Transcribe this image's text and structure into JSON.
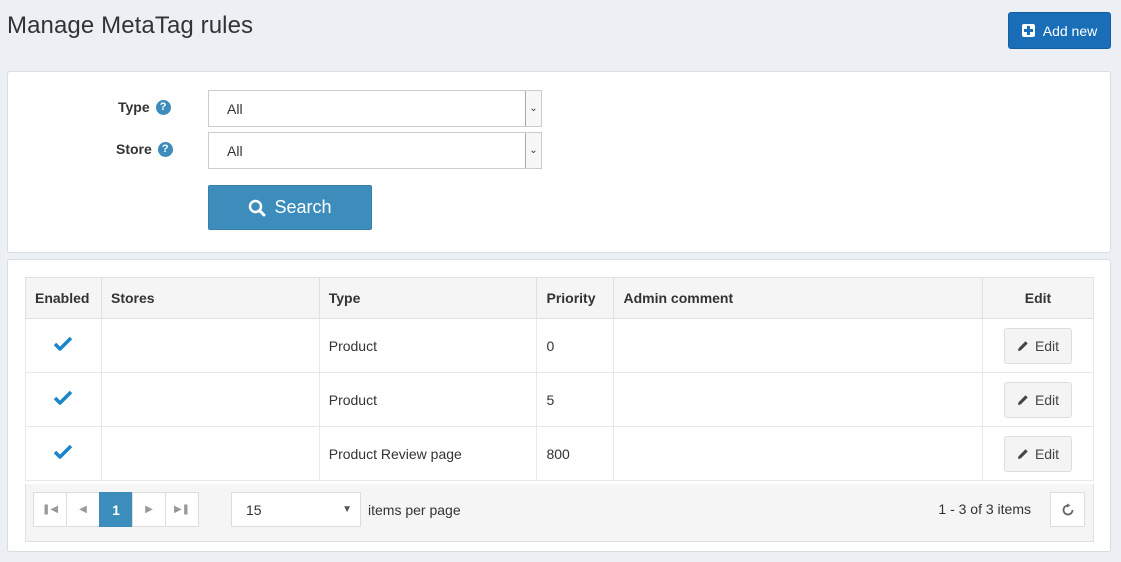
{
  "header": {
    "title": "Manage MetaTag rules",
    "add_new_label": "Add new"
  },
  "search": {
    "type_label": "Type",
    "type_value": "All",
    "store_label": "Store",
    "store_value": "All",
    "search_label": "Search"
  },
  "grid": {
    "columns": [
      "Enabled",
      "Stores",
      "Type",
      "Priority",
      "Admin comment",
      "Edit"
    ],
    "rows": [
      {
        "enabled": true,
        "stores": "",
        "type": "Product",
        "priority": "0",
        "comment": "",
        "edit": "Edit"
      },
      {
        "enabled": true,
        "stores": "",
        "type": "Product",
        "priority": "5",
        "comment": "",
        "edit": "Edit"
      },
      {
        "enabled": true,
        "stores": "",
        "type": "Product Review page",
        "priority": "800",
        "comment": "",
        "edit": "Edit"
      }
    ]
  },
  "pager": {
    "current_page": "1",
    "page_size": "15",
    "items_per_page_label": "items per page",
    "info": "1 - 3 of 3 items"
  },
  "colors": {
    "primary": "#1a6eb8",
    "info": "#3c8dbc",
    "check": "#1a85c8"
  },
  "icons": [
    "plus-square-icon",
    "help-icon",
    "chevron-down-icon",
    "search-icon",
    "check-icon",
    "pencil-icon",
    "first-page-icon",
    "prev-page-icon",
    "next-page-icon",
    "last-page-icon",
    "refresh-icon"
  ]
}
